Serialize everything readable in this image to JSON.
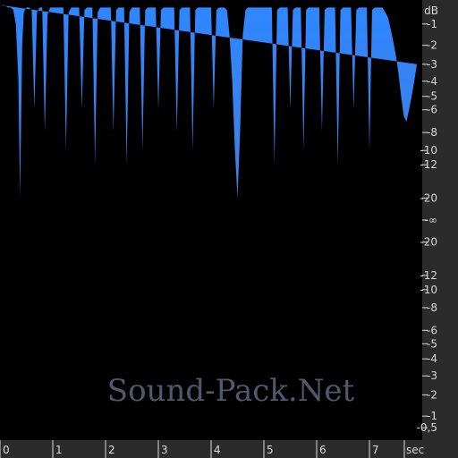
{
  "chart_data": {
    "type": "area",
    "title": "",
    "xlabel": "sec",
    "ylabel": "dB",
    "xlim": [
      0,
      8.0
    ],
    "x_ticks": [
      "0",
      "1",
      "2",
      "3",
      "4",
      "5",
      "6",
      "7"
    ],
    "db_ticks_upper": [
      "-1",
      "-2",
      "-3",
      "-4",
      "-5",
      "-6",
      "-8",
      "-10",
      "-12",
      "-20"
    ],
    "db_ticks_center": "-∞",
    "db_ticks_lower": [
      "-20",
      "-12",
      "-10",
      "-8",
      "-6",
      "-5",
      "-4",
      "-3",
      "-2",
      "-1",
      "-0,5"
    ],
    "grid": false,
    "series": [
      {
        "color": "#2f86ff",
        "x": [
          0.0,
          0.08,
          0.15,
          0.2,
          0.25,
          0.3,
          0.35,
          0.38,
          0.42,
          0.45,
          0.5,
          0.55,
          0.6,
          0.65,
          0.7,
          0.75,
          0.8,
          0.85,
          0.9,
          0.95,
          1.0,
          1.05,
          1.1,
          1.15,
          1.2,
          1.25,
          1.3,
          1.35,
          1.4,
          1.45,
          1.5,
          1.55,
          1.6,
          1.65,
          1.7,
          1.75,
          1.8,
          1.85,
          1.9,
          1.95,
          2.0,
          2.05,
          2.1,
          2.15,
          2.2,
          2.25,
          2.3,
          2.35,
          2.4,
          2.45,
          2.5,
          2.55,
          2.6,
          2.65,
          2.7,
          2.75,
          2.8,
          2.85,
          2.9,
          2.95,
          3.0,
          3.05,
          3.1,
          3.15,
          3.2,
          3.25,
          3.3,
          3.35,
          3.4,
          3.45,
          3.5,
          3.55,
          3.6,
          3.65,
          3.7,
          3.75,
          3.8,
          3.85,
          3.9,
          3.95,
          4.0,
          4.05,
          4.1,
          4.15,
          4.2,
          4.25,
          4.3,
          4.35,
          4.4,
          4.45,
          4.5,
          4.55,
          4.6,
          4.65,
          4.7,
          4.75,
          4.8,
          4.85,
          4.9,
          4.95,
          5.0,
          5.05,
          5.1,
          5.15,
          5.2,
          5.25,
          5.3,
          5.35,
          5.4,
          5.45,
          5.5,
          5.55,
          5.6,
          5.65,
          5.7,
          5.75,
          5.8,
          5.85,
          5.9,
          5.95,
          6.0,
          6.05,
          6.1,
          6.15,
          6.2,
          6.25,
          6.3,
          6.35,
          6.4,
          6.45,
          6.5,
          6.55,
          6.6,
          6.65,
          6.7,
          6.75,
          6.8,
          6.85,
          6.9,
          6.95,
          7.0,
          7.05,
          7.1,
          7.15,
          7.2,
          7.25,
          7.3,
          7.35,
          7.4,
          7.45,
          7.5,
          7.55,
          7.6,
          7.65,
          7.7,
          7.75,
          7.8,
          7.85,
          7.9,
          7.95,
          8.0
        ],
        "upper_db": [
          -0.2,
          -0.2,
          -0.3,
          -0.3,
          -0.4,
          -1.0,
          -4.0,
          -20.0,
          -2.0,
          -0.5,
          -0.3,
          -0.3,
          -0.4,
          -6.0,
          -0.5,
          -0.3,
          -0.3,
          -8.0,
          -0.6,
          -0.3,
          -0.3,
          -0.3,
          -0.3,
          -0.3,
          -0.3,
          -10.0,
          -0.5,
          -0.3,
          -0.3,
          -0.3,
          -0.3,
          -6.0,
          -0.4,
          -0.3,
          -0.3,
          -0.3,
          -12.0,
          -0.5,
          -0.3,
          -0.3,
          -0.3,
          -0.3,
          -0.3,
          -8.0,
          -0.4,
          -0.3,
          -0.3,
          -0.3,
          -12.0,
          -0.5,
          -0.3,
          -0.3,
          -0.3,
          -0.3,
          -10.0,
          -0.4,
          -0.3,
          -0.3,
          -0.3,
          -0.3,
          -6.0,
          -0.4,
          -0.3,
          -0.3,
          -0.3,
          -0.3,
          -0.3,
          -8.0,
          -0.4,
          -0.3,
          -0.3,
          -0.3,
          -0.3,
          -10.0,
          -0.4,
          -0.3,
          -0.3,
          -0.3,
          -0.3,
          -0.3,
          -0.3,
          -6.0,
          -0.4,
          -0.3,
          -0.3,
          -0.3,
          -0.4,
          -1.5,
          -4.0,
          -10.0,
          -20.0,
          -8.0,
          -1.5,
          -0.4,
          -0.3,
          -0.3,
          -0.3,
          -0.3,
          -0.3,
          -0.3,
          -0.3,
          -0.3,
          -0.3,
          -0.3,
          -12.0,
          -0.4,
          -0.3,
          -0.3,
          -0.3,
          -0.3,
          -6.0,
          -0.4,
          -0.3,
          -0.3,
          -0.3,
          -10.0,
          -0.4,
          -0.3,
          -0.3,
          -0.3,
          -0.3,
          -0.3,
          -8.0,
          -0.4,
          -0.3,
          -0.3,
          -0.3,
          -0.3,
          -12.0,
          -0.4,
          -0.3,
          -0.3,
          -0.3,
          -0.3,
          -6.0,
          -0.4,
          -0.3,
          -0.3,
          -0.3,
          -0.3,
          -10.0,
          -0.4,
          -0.3,
          -0.3,
          -0.3,
          -0.3,
          -0.5,
          -0.7,
          -1.2,
          -1.8,
          -2.5,
          -3.5,
          -5.0,
          -6.5,
          -7.0,
          -6.0,
          -5.0,
          -4.0,
          -3.0
        ],
        "lower_db": [
          -0.6,
          -0.6,
          -0.8,
          -1.0,
          -1.5,
          -3.0,
          -6.0,
          -20.0,
          -3.0,
          -1.2,
          -1.0,
          -1.0,
          -1.0,
          -6.0,
          -1.0,
          -1.0,
          -1.0,
          -8.0,
          -1.0,
          -1.0,
          -1.0,
          -1.0,
          -1.0,
          -1.0,
          -1.0,
          -10.0,
          -1.0,
          -1.0,
          -1.0,
          -1.0,
          -1.0,
          -6.0,
          -1.0,
          -1.0,
          -1.0,
          -1.0,
          -12.0,
          -1.0,
          -1.0,
          -1.0,
          -1.0,
          -1.0,
          -1.0,
          -8.0,
          -1.0,
          -1.0,
          -1.0,
          -1.0,
          -12.0,
          -1.0,
          -1.0,
          -1.0,
          -1.0,
          -1.0,
          -10.0,
          -1.0,
          -1.0,
          -1.0,
          -1.0,
          -1.0,
          -6.0,
          -1.0,
          -1.0,
          -1.0,
          -1.0,
          -1.0,
          -1.0,
          -8.0,
          -1.0,
          -1.0,
          -1.0,
          -1.0,
          -1.0,
          -10.0,
          -1.0,
          -1.0,
          -1.0,
          -1.0,
          -1.0,
          -1.0,
          -1.0,
          -6.0,
          -1.0,
          -1.0,
          -1.0,
          -1.0,
          -1.2,
          -2.5,
          -5.0,
          -10.0,
          -20.0,
          -8.0,
          -2.5,
          -1.2,
          -1.0,
          -1.0,
          -1.0,
          -1.0,
          -1.0,
          -1.0,
          -1.0,
          -1.0,
          -1.0,
          -1.0,
          -12.0,
          -1.0,
          -1.0,
          -1.0,
          -1.0,
          -1.0,
          -6.0,
          -1.0,
          -1.0,
          -1.0,
          -1.0,
          -10.0,
          -1.0,
          -1.0,
          -1.0,
          -1.0,
          -1.0,
          -1.0,
          -8.0,
          -1.0,
          -1.0,
          -1.0,
          -1.0,
          -1.0,
          -12.0,
          -1.0,
          -1.0,
          -1.0,
          -1.0,
          -1.0,
          -6.0,
          -1.0,
          -1.0,
          -1.0,
          -1.0,
          -1.0,
          -10.0,
          -1.0,
          -1.0,
          -1.0,
          -1.0,
          -1.0,
          -1.2,
          -1.5,
          -2.0,
          -2.5,
          -3.5,
          -4.0,
          -4.0,
          -3.0,
          -2.5,
          -2.0,
          -2.5,
          -3.0,
          -5.0
        ]
      }
    ]
  },
  "colors": {
    "background": "#000000",
    "waveform_top": "#2f86ff",
    "waveform_bottom": "#3f7fe0",
    "scale_text": "#d8d8d8",
    "panel": "#2b2b2b"
  },
  "watermark": {
    "text": "Sound-Pack.Net"
  }
}
